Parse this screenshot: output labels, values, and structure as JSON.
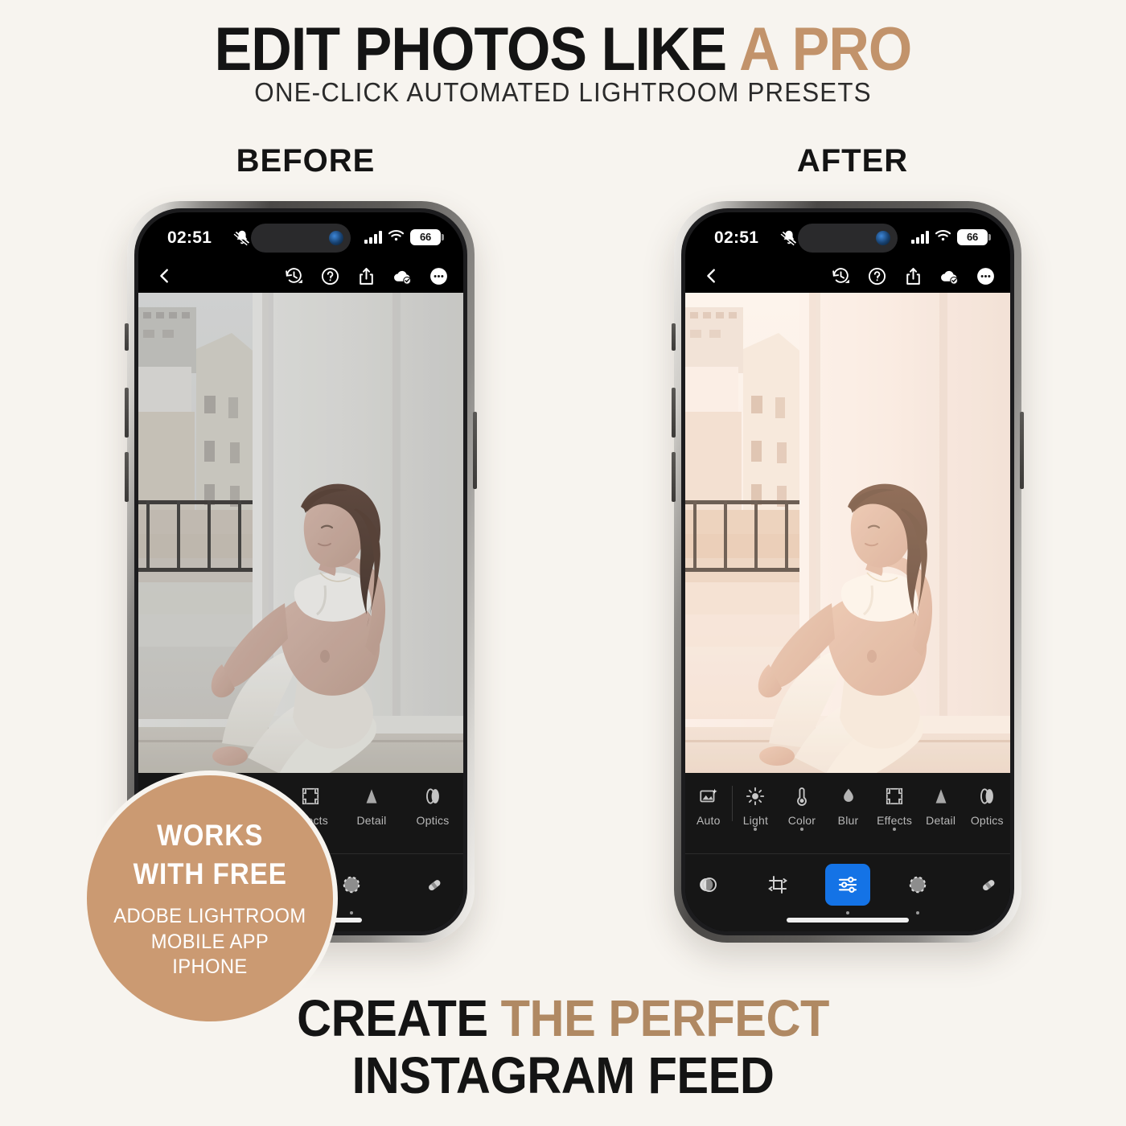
{
  "headline": {
    "line1_dark": "EDIT PHOTOS LIKE ",
    "line1_accent": "A PRO",
    "subtitle": "ONE-CLICK AUTOMATED LIGHTROOM PRESETS"
  },
  "comparison": {
    "before_label": "BEFORE",
    "after_label": "AFTER"
  },
  "phone": {
    "status": {
      "time": "02:51",
      "mute_icon": "bell-slash-icon",
      "signal_icon": "cellular-bars-icon",
      "wifi_icon": "wifi-icon",
      "battery_level": "66"
    },
    "toolbar": {
      "back_icon": "chevron-left-icon",
      "icons": [
        {
          "name": "history-icon",
          "label": "Version History"
        },
        {
          "name": "help-icon",
          "label": "Help"
        },
        {
          "name": "share-icon",
          "label": "Share"
        },
        {
          "name": "cloud-check-icon",
          "label": "Synced"
        },
        {
          "name": "more-icon",
          "label": "More"
        }
      ]
    },
    "editor": {
      "tools_full": [
        {
          "label": "Auto",
          "icon": "auto-enhance-icon",
          "dot": false
        },
        {
          "label": "Light",
          "icon": "sun-icon",
          "dot": true
        },
        {
          "label": "Color",
          "icon": "thermometer-icon",
          "dot": true
        },
        {
          "label": "Blur",
          "icon": "droplet-icon",
          "dot": false
        },
        {
          "label": "Effects",
          "icon": "frame-icon",
          "dot": true
        },
        {
          "label": "Detail",
          "icon": "triangle-icon",
          "dot": false
        },
        {
          "label": "Optics",
          "icon": "lens-icon",
          "dot": false
        }
      ],
      "tools_partial": [
        {
          "label": "Effects",
          "icon": "frame-icon",
          "dot": true
        },
        {
          "label": "Detail",
          "icon": "triangle-icon",
          "dot": false
        },
        {
          "label": "Optics",
          "icon": "lens-icon",
          "dot": false
        }
      ],
      "modes_full": [
        {
          "name": "presets-mode",
          "icon": "presets-icon",
          "active": false,
          "dot": false
        },
        {
          "name": "crop-mode",
          "icon": "crop-icon",
          "active": false,
          "dot": false
        },
        {
          "name": "edit-mode",
          "icon": "sliders-icon",
          "active": true,
          "dot": true
        },
        {
          "name": "masking-mode",
          "icon": "masking-icon",
          "active": false,
          "dot": true
        },
        {
          "name": "healing-mode",
          "icon": "healing-icon",
          "active": false,
          "dot": false
        }
      ],
      "modes_partial": [
        {
          "name": "masking-mode",
          "icon": "masking-icon",
          "active": false,
          "dot": true
        },
        {
          "name": "healing-mode",
          "icon": "healing-icon",
          "active": false,
          "dot": false
        }
      ],
      "active_mode_color": "#1473e6"
    }
  },
  "badge": {
    "line1": "WORKS",
    "line2": "WITH FREE",
    "line3": "ADOBE LIGHTROOM",
    "line4": "MOBILE APP",
    "line5": "IPHONE",
    "background_color": "#cb9a72"
  },
  "footer": {
    "line1_dark": "CREATE ",
    "line1_accent": "THE PERFECT",
    "line2": "INSTAGRAM FEED"
  },
  "theme": {
    "background": "#f7f4ef",
    "text_dark": "#141414",
    "accent_tan": "#c2936b"
  },
  "photo": {
    "subject": "pregnant-woman-seated-by-window",
    "before_mood": "cool-grey-flat",
    "after_mood": "warm-bright-peach"
  }
}
